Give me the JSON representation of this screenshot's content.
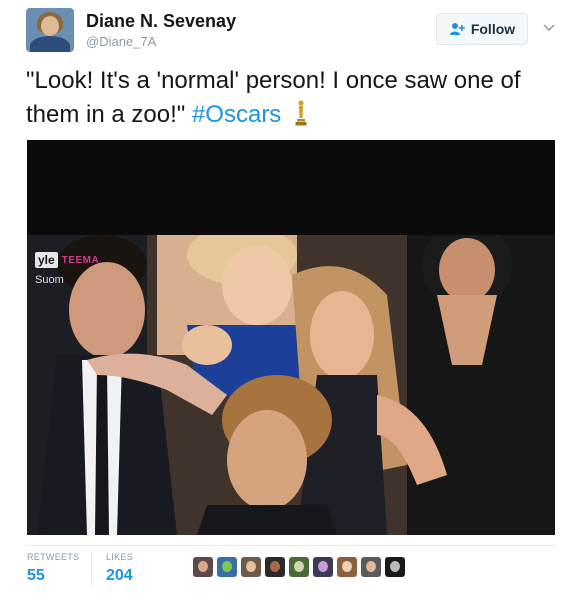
{
  "user": {
    "name": "Diane N. Sevenay",
    "handle": "@Diane_7A"
  },
  "follow": {
    "label": "Follow"
  },
  "tweet": {
    "text": "\"Look! It's a 'normal' person! I once saw one of them in a zoo!\"",
    "hashtag": "#Oscars"
  },
  "media": {
    "overlay_logo": "yle",
    "overlay_teema": "TEEMA",
    "overlay_channel": "Suom"
  },
  "stats": {
    "retweets_label": "RETWEETS",
    "retweets": "55",
    "likes_label": "LIKES",
    "likes": "204"
  },
  "likers": [
    {
      "bg": "#5a4a4a",
      "face": "#d9a88a"
    },
    {
      "bg": "#3b6ea8",
      "face": "#7ec850"
    },
    {
      "bg": "#6f5a48",
      "face": "#e5c2a0"
    },
    {
      "bg": "#2a2a2a",
      "face": "#a36b4a"
    },
    {
      "bg": "#4a6a3a",
      "face": "#cfd8b0"
    },
    {
      "bg": "#3a3a55",
      "face": "#c99bd6"
    },
    {
      "bg": "#8a6040",
      "face": "#f0d0b0"
    },
    {
      "bg": "#5a5a5a",
      "face": "#e0b8a0"
    },
    {
      "bg": "#1a1a1a",
      "face": "#bbbbbb"
    }
  ],
  "colors": {
    "accent": "#1b95e0",
    "text": "#14171a",
    "muted": "#8899a6"
  }
}
